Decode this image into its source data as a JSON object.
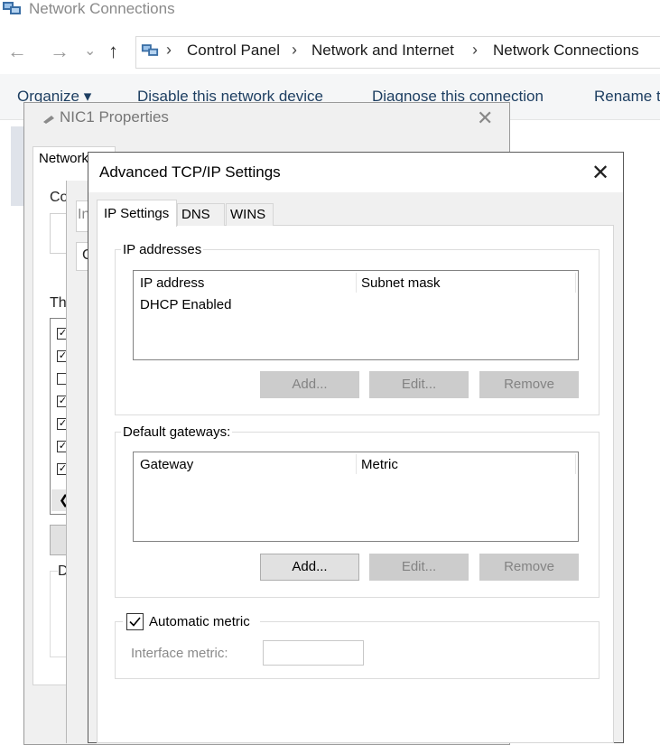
{
  "explorer": {
    "title": "Network Connections",
    "breadcrumb": [
      "Control Panel",
      "Network and Internet",
      "Network Connections"
    ],
    "nav": {
      "back": "←",
      "forward": "→",
      "recent": "⌄",
      "up": "↑"
    },
    "commands": [
      "Organize ▾",
      "Disable this network device",
      "Diagnose this connection",
      "Rename t"
    ]
  },
  "nic_dialog": {
    "title": "NIC1 Properties",
    "tab": "Networking",
    "fragments": {
      "connect": "Co",
      "this": "Th",
      "desc": "D"
    },
    "checkboxes": [
      true,
      true,
      false,
      true,
      true,
      true,
      true
    ],
    "middle_fragments": {
      "a": "In",
      "b": "C"
    }
  },
  "advanced": {
    "title": "Advanced TCP/IP Settings",
    "close": "✕",
    "tabs": [
      "IP Settings",
      "DNS",
      "WINS"
    ],
    "ip_group": {
      "legend": "IP addresses",
      "columns": [
        "IP address",
        "Subnet mask"
      ],
      "rows": [
        "DHCP Enabled"
      ],
      "buttons": {
        "add": "Add...",
        "edit": "Edit...",
        "remove": "Remove"
      }
    },
    "gw_group": {
      "legend": "Default gateways:",
      "columns": [
        "Gateway",
        "Metric"
      ],
      "buttons": {
        "add": "Add...",
        "edit": "Edit...",
        "remove": "Remove"
      }
    },
    "metric_group": {
      "checkbox_label": "Automatic metric",
      "checked": true,
      "interface_metric_label": "Interface metric:",
      "interface_metric_value": ""
    }
  }
}
